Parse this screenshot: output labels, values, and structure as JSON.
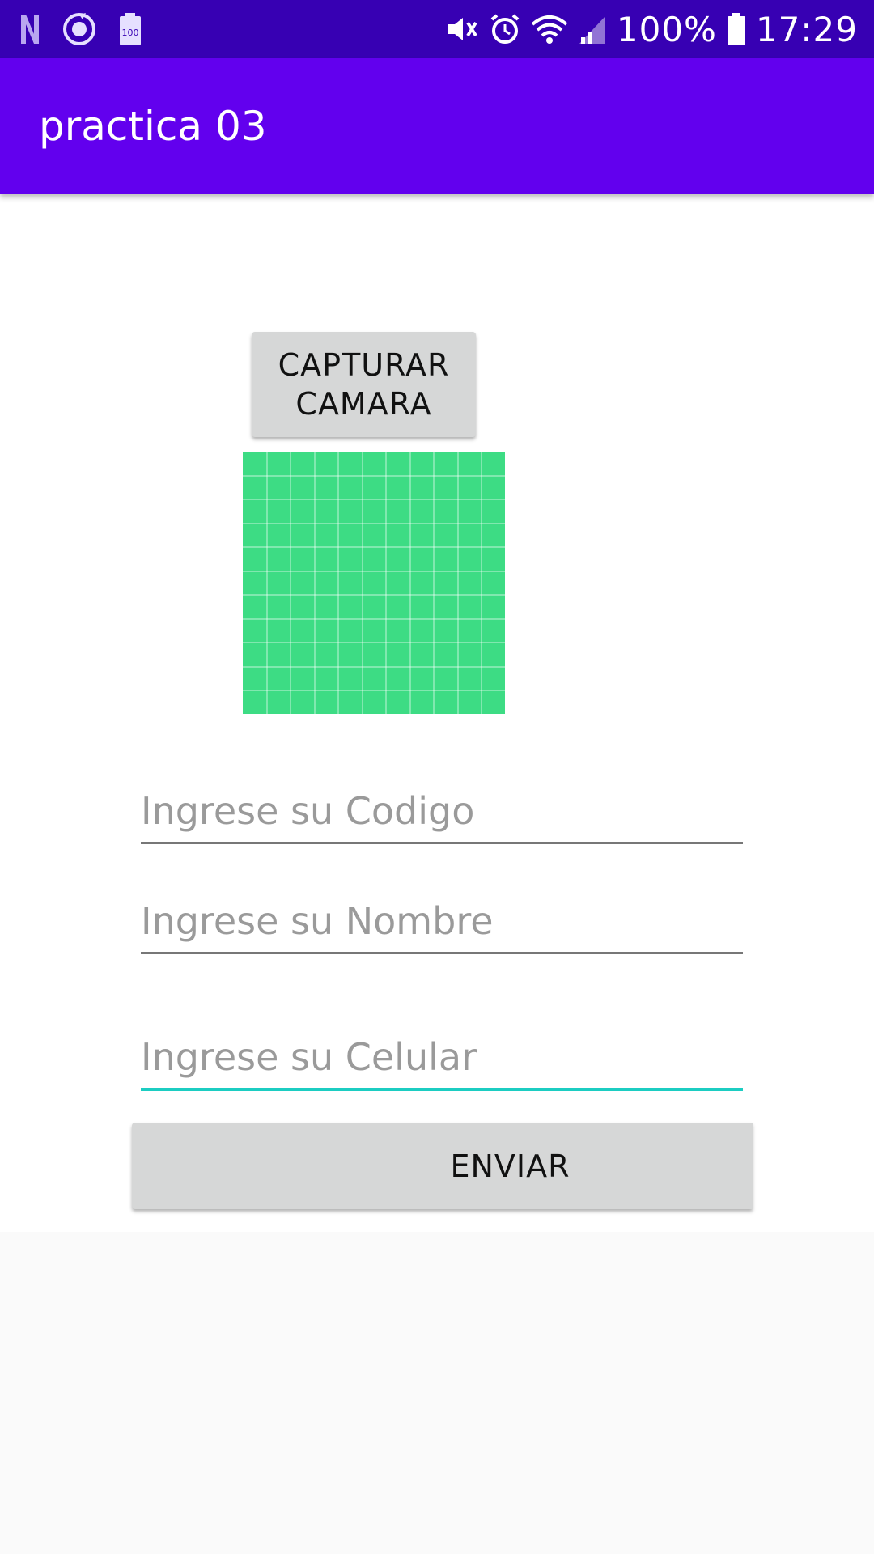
{
  "status_bar": {
    "left_icons": [
      "netflix-n-icon",
      "sync-circle-icon",
      "battery-100-icon"
    ],
    "battery_badge": "100",
    "right_icons": [
      "mute-icon",
      "alarm-icon",
      "wifi-icon",
      "signal-icon"
    ],
    "battery_percent": "100%",
    "time": "17:29",
    "color": "#3700b3"
  },
  "app_bar": {
    "title": "practica 03",
    "color": "#6200ee"
  },
  "main": {
    "capture_button": "CAPTURAR\nCAMARA",
    "image_placeholder_icon": "green-grid-image",
    "image_color": "#3ddc84",
    "fields": [
      {
        "placeholder": "Ingrese su Codigo",
        "value": ""
      },
      {
        "placeholder": "Ingrese su Nombre",
        "value": ""
      },
      {
        "placeholder": "Ingrese su Celular",
        "value": "",
        "focused": true
      }
    ],
    "focus_color": "#1ccdc2",
    "send_button": "ENVIAR"
  }
}
